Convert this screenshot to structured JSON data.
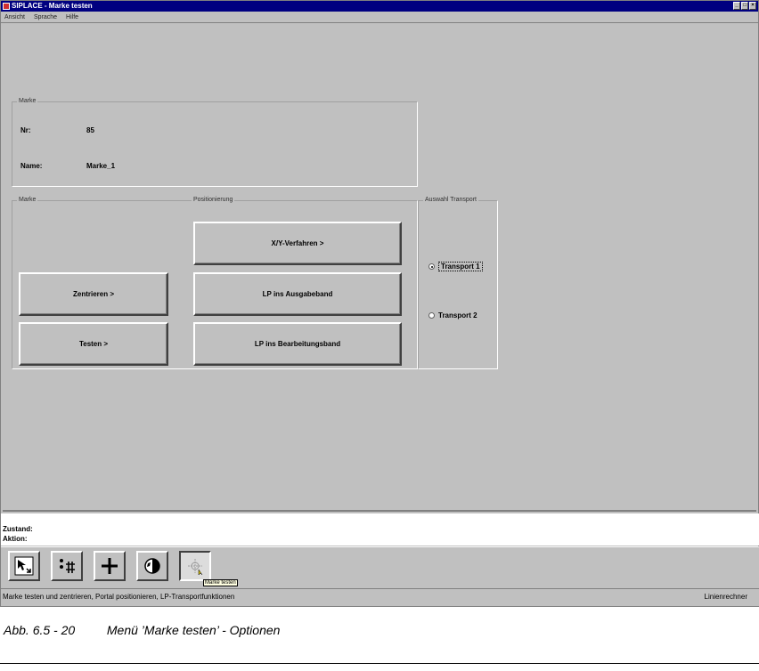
{
  "window": {
    "title": "SIPLACE - Marke testen"
  },
  "menu": [
    "Ansicht",
    "Sprache",
    "Hilfe"
  ],
  "marke_info": {
    "group_title": "Marke",
    "nr_label": "Nr:",
    "nr_value": "85",
    "name_label": "Name:",
    "name_value": "Marke_1"
  },
  "marke_group": {
    "title": "Marke",
    "zentrieren": "Zentrieren >",
    "testen": "Testen >"
  },
  "positionierung": {
    "title": "Positionierung",
    "xy": "X/Y-Verfahren >",
    "ausgabe": "LP ins Ausgabeband",
    "bearbeitung": "LP ins Bearbeitungsband"
  },
  "transport": {
    "title": "Auswahl Transport",
    "options": [
      {
        "label": "Transport 1",
        "checked": true
      },
      {
        "label": "Transport 2",
        "checked": false
      }
    ]
  },
  "status": {
    "zustand": "Zustand:",
    "aktion": "Aktion:"
  },
  "toolbar": {
    "tools": [
      "pointer-select-icon",
      "grid-icon",
      "crosshair-icon",
      "globe-icon",
      "target-icon"
    ],
    "tooltip": "Marke testen"
  },
  "statusbar": {
    "left": "Marke testen und zentrieren, Portal positionieren, LP-Transportfunktionen",
    "right": "Linienrechner"
  },
  "caption": {
    "number": "Abb. 6.5 - 20",
    "text": "Menü ’Marke testen’ - Optionen"
  }
}
